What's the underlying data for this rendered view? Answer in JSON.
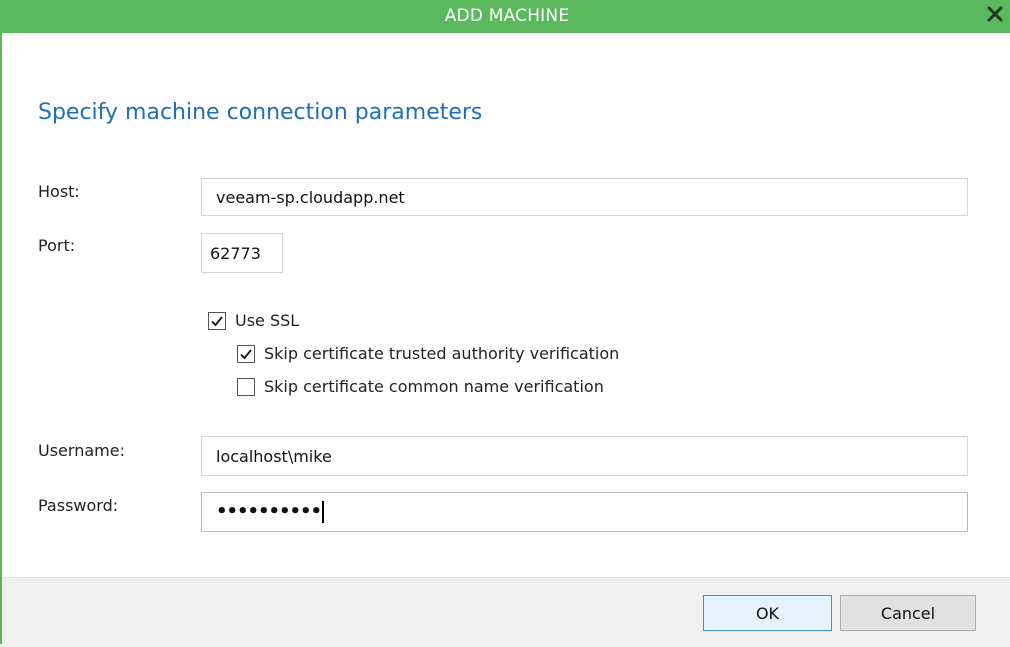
{
  "window": {
    "title": "ADD MACHINE",
    "accent_color": "#5cb85c",
    "close_icon": "close-icon"
  },
  "heading": "Specify machine connection parameters",
  "fields": {
    "host": {
      "label": "Host:",
      "value": "veeam-sp.cloudapp.net"
    },
    "port": {
      "label": "Port:",
      "value": "62773"
    },
    "username": {
      "label": "Username:",
      "value": "localhost\\mike"
    },
    "password": {
      "label": "Password:",
      "value": "••••••••••"
    }
  },
  "options": {
    "use_ssl": {
      "label": "Use SSL",
      "checked": true
    },
    "skip_trusted_authority": {
      "label": "Skip certificate trusted authority verification",
      "checked": true
    },
    "skip_common_name": {
      "label": "Skip certificate common name verification",
      "checked": false
    }
  },
  "buttons": {
    "ok": "OK",
    "cancel": "Cancel"
  }
}
